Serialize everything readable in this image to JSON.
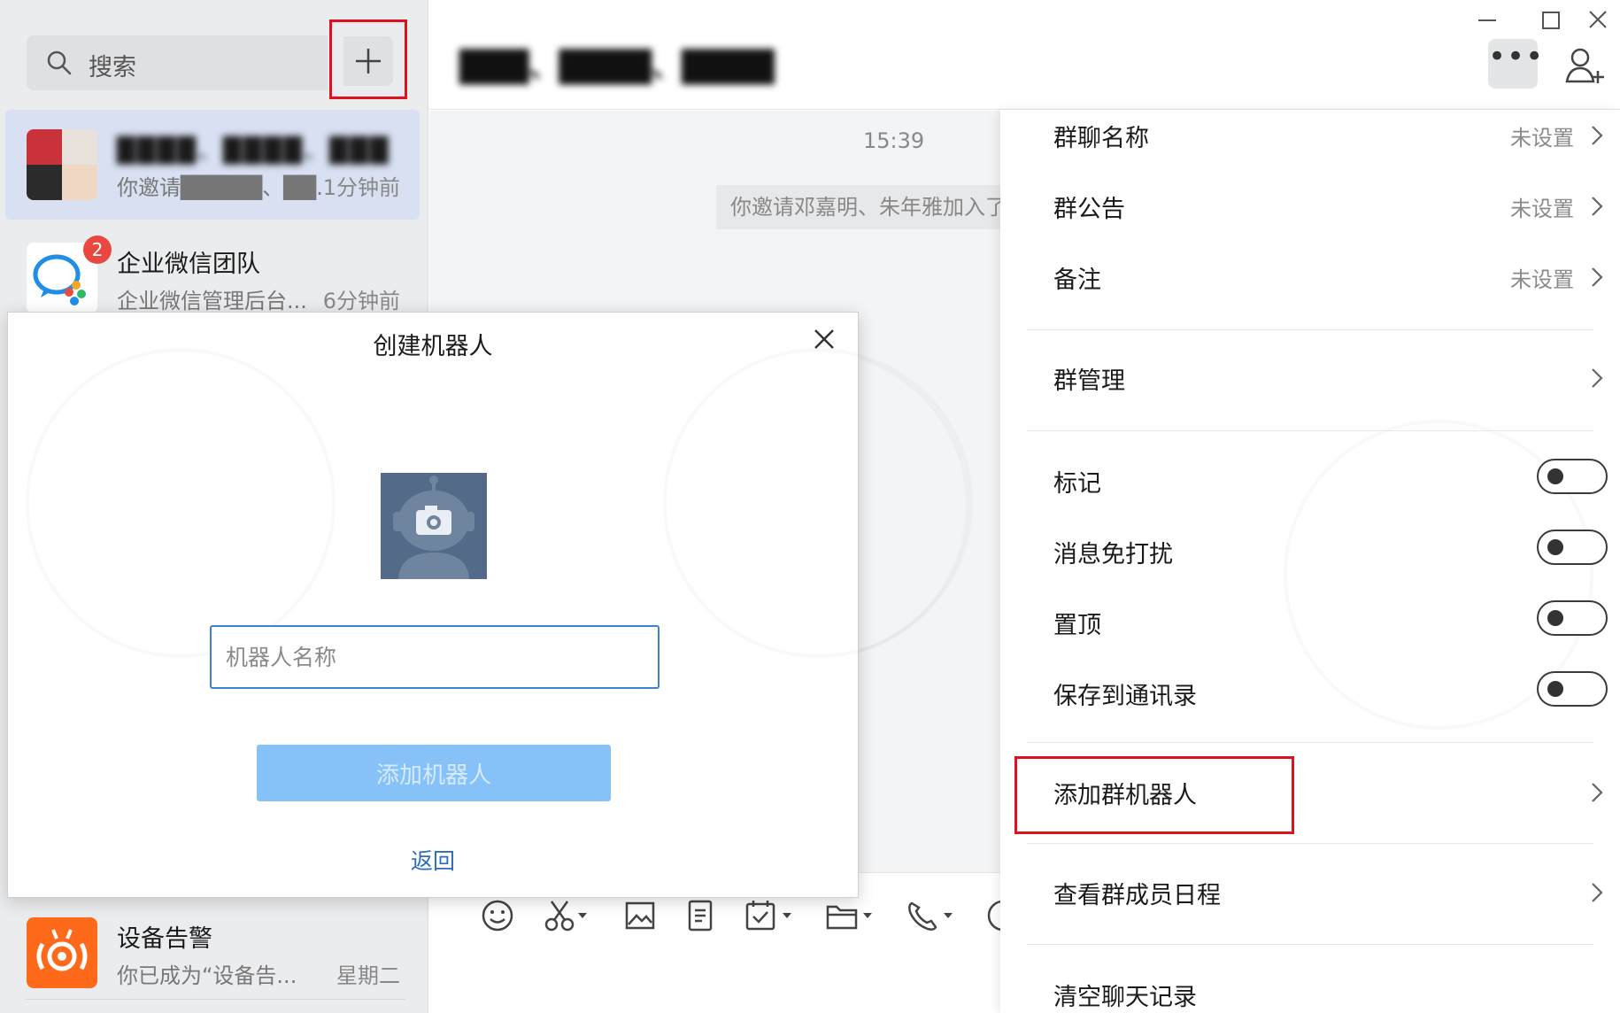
{
  "sidebar": {
    "search_placeholder": "搜索",
    "conversations": [
      {
        "name": "████、████、███",
        "snippet": "你邀请█████、██.",
        "time": "1分钟前"
      },
      {
        "name": "企业微信团队",
        "snippet": "企业微信管理后台...",
        "time": "6分钟前",
        "unread": "2"
      },
      {
        "name": "设备告警",
        "snippet": "你已成为“设备告...",
        "time": "星期二"
      }
    ]
  },
  "header": {
    "title": "███、████、████"
  },
  "chat": {
    "time": "15:39",
    "system_message": "你邀请邓嘉明、朱年雅加入了"
  },
  "settings": {
    "group_name_label": "群聊名称",
    "group_name_value": "未设置",
    "announcement_label": "群公告",
    "announcement_value": "未设置",
    "remark_label": "备注",
    "remark_value": "未设置",
    "manage_label": "群管理",
    "mark_label": "标记",
    "mute_label": "消息免打扰",
    "pin_label": "置顶",
    "save_contacts_label": "保存到通讯录",
    "add_robot_label": "添加群机器人",
    "schedule_label": "查看群成员日程",
    "clear_history_label": "清空聊天记录",
    "toggles": {
      "mark": false,
      "mute": false,
      "pin": false,
      "save_contacts": false
    }
  },
  "dialog": {
    "title": "创建机器人",
    "input_placeholder": "机器人名称",
    "add_button": "添加机器人",
    "back_link": "返回"
  },
  "colors": {
    "highlight": "#e0101e",
    "primary_button_disabled": "#86c2f7",
    "link": "#2d6dbb",
    "badge": "#e8483f"
  }
}
